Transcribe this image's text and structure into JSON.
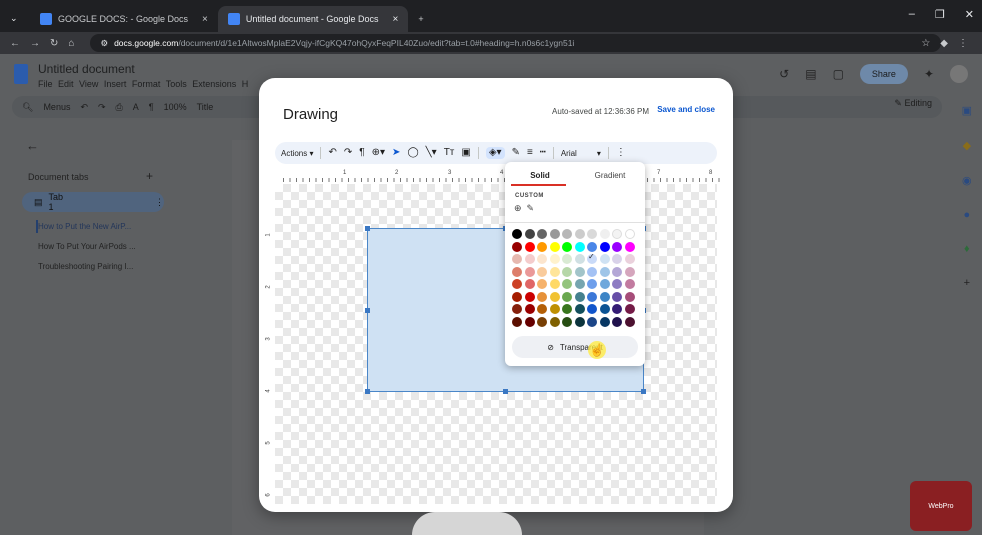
{
  "browser": {
    "tabs": [
      {
        "label": "GOOGLE DOCS: - Google Docs",
        "close": "×"
      },
      {
        "label": "Untitled document - Google Docs",
        "close": "×"
      }
    ],
    "new_tab": "+",
    "url_host": "docs.google.com",
    "url_path": "/document/d/1e1AltwosMplaE2Vqjy-ifCgKQ47ohQyxFeqPIL40Zuo/edit?tab=t.0#heading=h.n0s6c1ygn51i"
  },
  "docs": {
    "title": "Untitled document",
    "menu": "File  Edit  View  Insert  Format  Tools  Extensions  H",
    "share_label": "Share",
    "toolbar": {
      "menus_label": "Menus",
      "zoom": "100%",
      "style": "Title"
    },
    "editing_label": "Editing",
    "document_tabs_label": "Document tabs",
    "tab1_label": "Tab 1",
    "outline": [
      "How to Put the New AirP...",
      "How To Put Your AirPods ...",
      "Troubleshooting Pairing I..."
    ]
  },
  "drawing": {
    "title": "Drawing",
    "autosave": "Auto-saved at 12:36:36 PM",
    "save_close": "Save and close",
    "actions_label": "Actions",
    "font": "Arial",
    "ruler_numbers": [
      "1",
      "2",
      "3",
      "4",
      "7",
      "8"
    ],
    "vruler_numbers": [
      "1",
      "2",
      "3",
      "4",
      "5",
      "6"
    ]
  },
  "palette": {
    "tab_solid": "Solid",
    "tab_gradient": "Gradient",
    "custom_label": "CUSTOM",
    "transparent_label": "Transparent",
    "selected_swatch": "#c9daf8",
    "rows": [
      [
        "#000000",
        "#434343",
        "#666666",
        "#999999",
        "#b7b7b7",
        "#cccccc",
        "#d9d9d9",
        "#efefef",
        "#f3f3f3",
        "#ffffff"
      ],
      [
        "#980000",
        "#ff0000",
        "#ff9900",
        "#ffff00",
        "#00ff00",
        "#00ffff",
        "#4a86e8",
        "#0000ff",
        "#9900ff",
        "#ff00ff"
      ],
      [
        "#e6b8af",
        "#f4cccc",
        "#fce5cd",
        "#fff2cc",
        "#d9ead3",
        "#d0e0e3",
        "#c9daf8",
        "#cfe2f3",
        "#d9d2e9",
        "#ead1dc"
      ],
      [
        "#dd7e6b",
        "#ea9999",
        "#f9cb9c",
        "#ffe599",
        "#b6d7a8",
        "#a2c4c9",
        "#a4c2f4",
        "#9fc5e8",
        "#b4a7d6",
        "#d5a6bd"
      ],
      [
        "#cc4125",
        "#e06666",
        "#f6b26b",
        "#ffd966",
        "#93c47d",
        "#76a5af",
        "#6d9eeb",
        "#6fa8dc",
        "#8e7cc3",
        "#c27ba0"
      ],
      [
        "#a61c00",
        "#cc0000",
        "#e69138",
        "#f1c232",
        "#6aa84f",
        "#45818e",
        "#3c78d8",
        "#3d85c6",
        "#674ea7",
        "#a64d79"
      ],
      [
        "#85200c",
        "#990000",
        "#b45f06",
        "#bf9000",
        "#38761d",
        "#134f5c",
        "#1155cc",
        "#0b5394",
        "#351c75",
        "#741b47"
      ],
      [
        "#5b0f00",
        "#660000",
        "#783f04",
        "#7f6000",
        "#274e13",
        "#0c343d",
        "#1c4587",
        "#073763",
        "#20124d",
        "#4c1130"
      ]
    ]
  },
  "watermark": "WebPro"
}
